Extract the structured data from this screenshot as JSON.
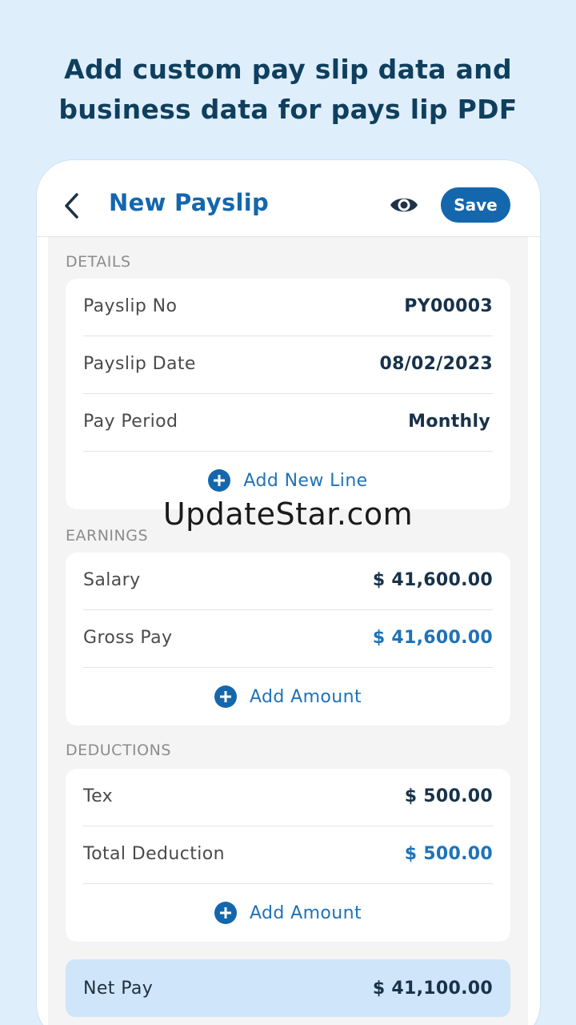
{
  "promo": {
    "line1": "Add custom pay slip data and",
    "line2": "business data for pays lip PDF"
  },
  "appbar": {
    "title": "New Payslip",
    "save_label": "Save"
  },
  "details": {
    "label": "DETAILS",
    "rows": [
      {
        "label": "Payslip No",
        "value": "PY00003"
      },
      {
        "label": "Payslip Date",
        "value": "08/02/2023"
      },
      {
        "label": "Pay Period",
        "value": "Monthly"
      }
    ],
    "add_label": "Add New Line"
  },
  "earnings": {
    "label": "EARNINGS",
    "rows": [
      {
        "label": "Salary",
        "value": "$ 41,600.00"
      },
      {
        "label": "Gross Pay",
        "value": "$ 41,600.00"
      }
    ],
    "add_label": "Add Amount"
  },
  "deductions": {
    "label": "DEDUCTIONS",
    "rows": [
      {
        "label": "Tex",
        "value": "$ 500.00"
      },
      {
        "label": "Total Deduction",
        "value": "$ 500.00"
      }
    ],
    "add_label": "Add Amount"
  },
  "netpay": {
    "label": "Net Pay",
    "value": "$ 41,100.00"
  },
  "watermark": "UpdateStar.com",
  "colors": {
    "accent": "#1467ad",
    "background": "#dfeefb",
    "netpay_bg": "#cfe6fa"
  }
}
